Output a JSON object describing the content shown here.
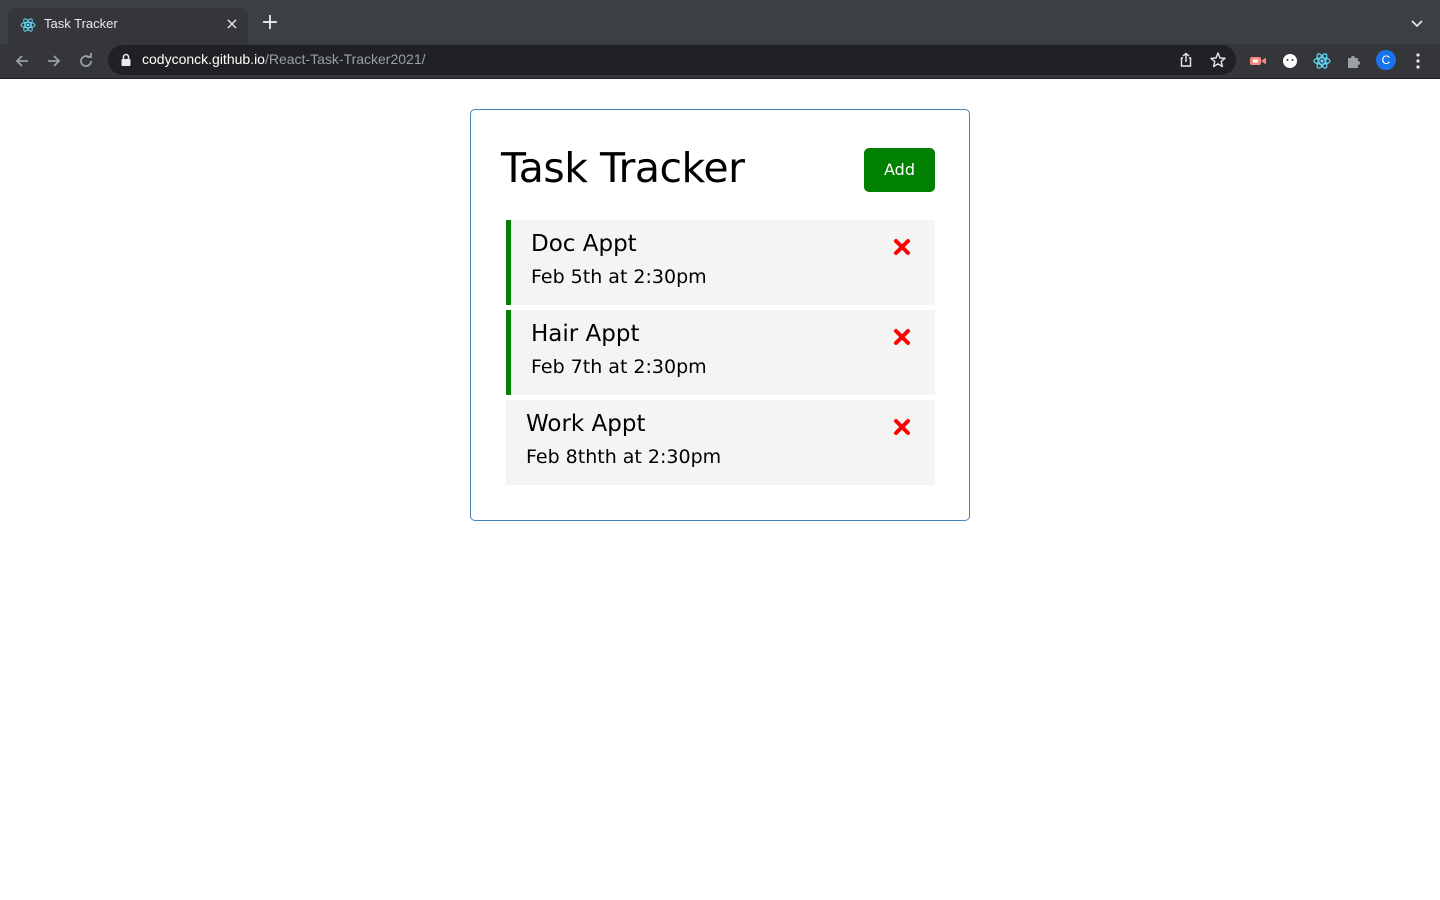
{
  "browser": {
    "tab_title": "Task Tracker",
    "tab_close": "×",
    "new_tab": "+",
    "url_host": "codyconck.github.io",
    "url_path": "/React-Task-Tracker2021/",
    "profile_initial": "C"
  },
  "app": {
    "title": "Task Tracker",
    "add_label": "Add",
    "accent_color": "#008000",
    "delete_color": "#ff0000",
    "tasks": [
      {
        "text": "Doc Appt",
        "day": "Feb 5th at 2:30pm",
        "reminder": true
      },
      {
        "text": "Hair Appt",
        "day": "Feb 7th at 2:30pm",
        "reminder": true
      },
      {
        "text": "Work Appt",
        "day": "Feb 8thth at 2:30pm",
        "reminder": false
      }
    ]
  }
}
